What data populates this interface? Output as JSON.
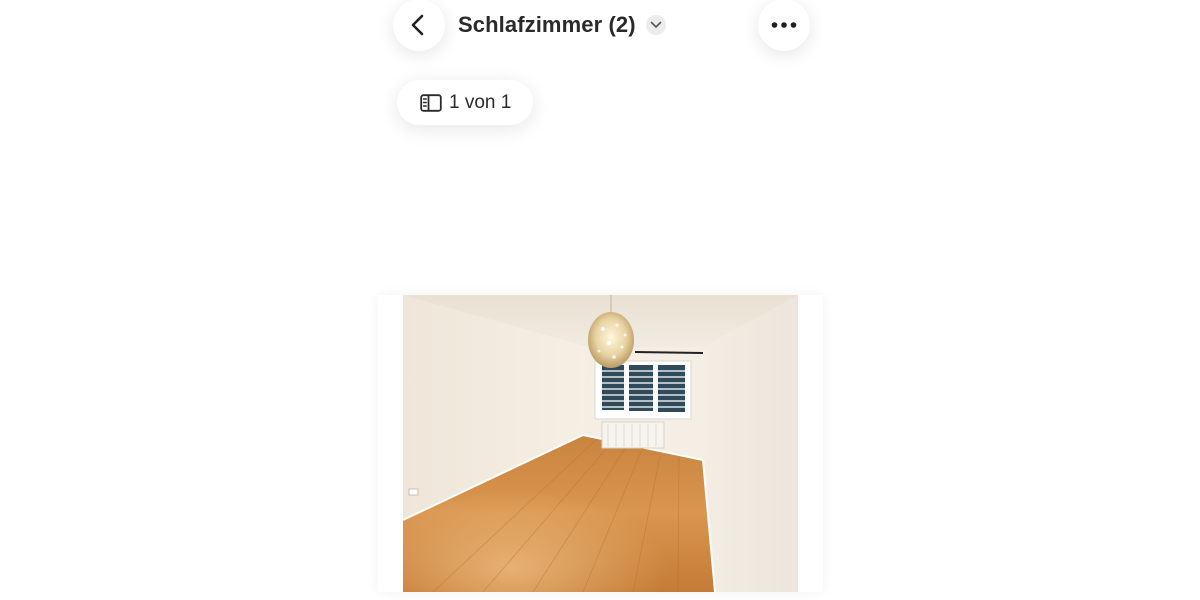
{
  "header": {
    "title": "Schlafzimmer (2)",
    "back_icon": "chevron-left-icon",
    "dropdown_icon": "chevron-down-icon",
    "more_icon": "more-horizontal-icon"
  },
  "counter": {
    "icon": "gallery-sidebar-icon",
    "label": "1 von 1"
  },
  "photo": {
    "alt": "Schlafzimmer (2)",
    "subject": "empty bedroom with wooden floor, white walls, chandelier and window"
  },
  "colors": {
    "text": "#2a2a2a",
    "button_bg": "#ffffff",
    "caret_bg": "#ececec"
  }
}
